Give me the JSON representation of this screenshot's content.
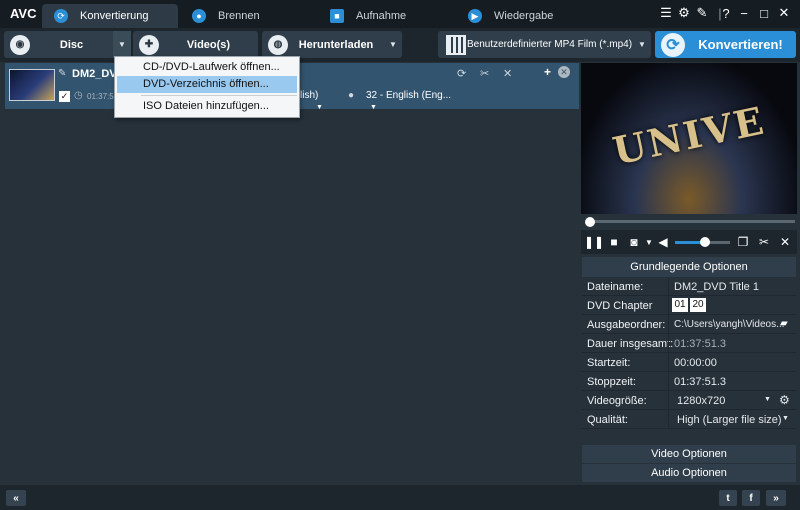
{
  "app": {
    "logo": "AVC"
  },
  "tabs": [
    {
      "label": "Konvertierung",
      "icon": "refresh-icon"
    },
    {
      "label": "Brennen",
      "icon": "disc-icon"
    },
    {
      "label": "Aufnahme",
      "icon": "record-icon"
    },
    {
      "label": "Wiedergabe",
      "icon": "play-icon"
    }
  ],
  "toolbar": {
    "disc_label": "Disc",
    "videos_label": "Video(s)",
    "download_label": "Herunterladen",
    "profile_label": "Benutzerdefinierter MP4 Film (*.mp4)",
    "convert_label": "Konvertieren!"
  },
  "menu": {
    "items": [
      "CD-/DVD-Laufwerk öffnen...",
      "DVD-Verzeichnis öffnen...",
      "ISO Dateien hinzufügen..."
    ],
    "selected_index": 1
  },
  "file": {
    "name": "DM2_DVD",
    "time": "01:37:5",
    "audio_track_tail": "lish)",
    "subtitle": "32 - English (Eng..."
  },
  "options": {
    "header": "Grundlegende Optionen",
    "rows": [
      {
        "label": "Dateiname:",
        "value": "DM2_DVD Title 1"
      },
      {
        "label": "DVD Chapter",
        "from": "01",
        "to": "20"
      },
      {
        "label": "Ausgabeordner:",
        "value": "C:\\Users\\yangh\\Videos..."
      },
      {
        "label": "Dauer insgesamt:",
        "value": "01:37:51.3"
      },
      {
        "label": "Startzeit:",
        "value": "00:00:00"
      },
      {
        "label": "Stoppzeit:",
        "value": "01:37:51.3"
      },
      {
        "label": "Videogröße:",
        "value": "1280x720"
      },
      {
        "label": "Qualität:",
        "value": "High (Larger file size)"
      }
    ],
    "video_options": "Video Optionen",
    "audio_options": "Audio Optionen"
  },
  "preview": {
    "seek_position": 0.0,
    "volume_level": 0.55
  },
  "colors": {
    "accent": "#2a8fd6",
    "selection": "#99c9ef",
    "row_selected": "#33546f"
  }
}
